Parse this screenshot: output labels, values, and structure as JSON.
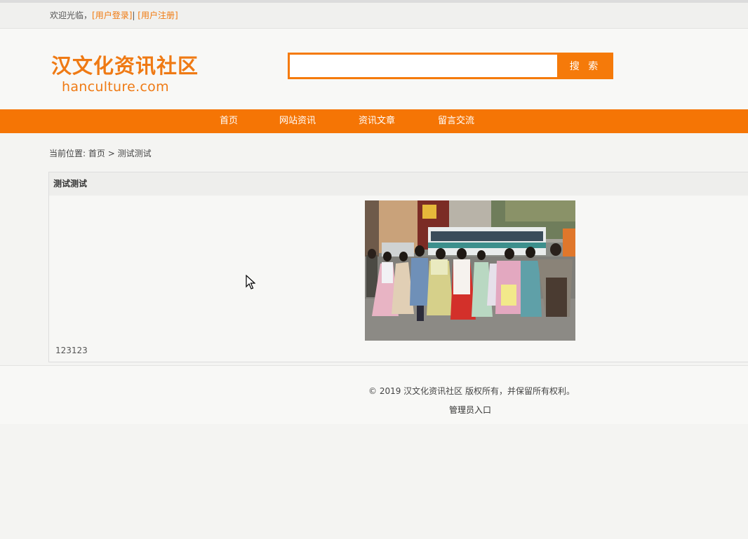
{
  "topbar": {
    "welcome": "欢迎光临，",
    "login": "[用户登录]",
    "separator": "|",
    "register": "[用户注册]"
  },
  "header": {
    "logo_cn": "汉文化资讯社区",
    "logo_en": "hanculture.com",
    "search_placeholder": "",
    "search_button": "搜 索"
  },
  "nav": {
    "items": [
      "首页",
      "网站资讯",
      "资讯文章",
      "留言交流"
    ]
  },
  "breadcrumb": {
    "prefix": "当前位置: ",
    "home": "首页",
    "arrow": " > ",
    "current": "测试测试"
  },
  "article": {
    "title": "测试测试",
    "body_text": "123123",
    "image_icon": "photo-people-in-hanfu"
  },
  "footer": {
    "copyright": "© 2019 汉文化资讯社区 版权所有，并保留所有权利。",
    "admin_link": "管理员入口"
  },
  "colors": {
    "accent": "#f57505",
    "logo": "#ef7a14"
  }
}
